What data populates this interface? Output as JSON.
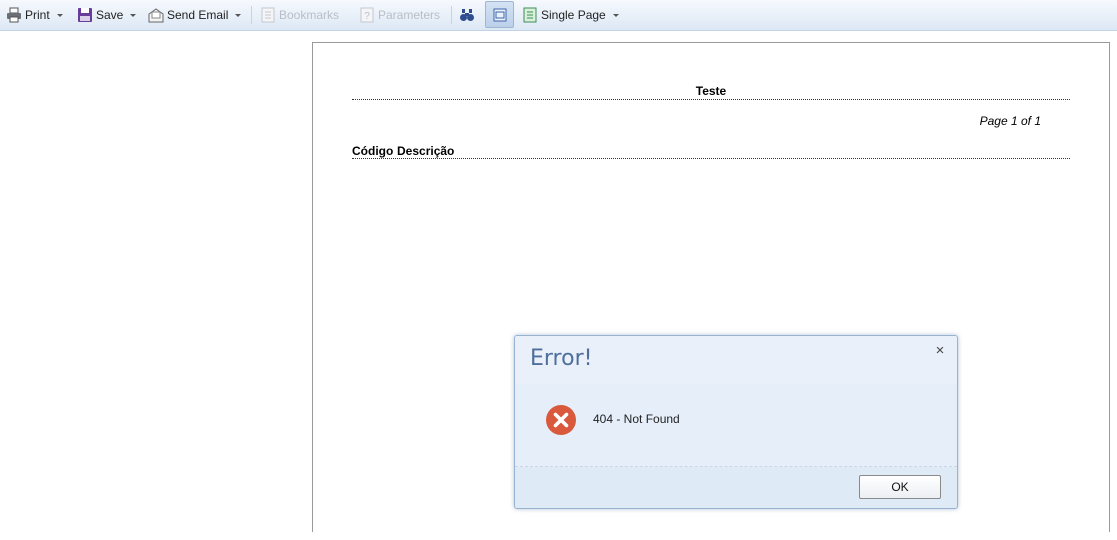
{
  "toolbar": {
    "print_label": "Print",
    "save_label": "Save",
    "send_email_label": "Send Email",
    "bookmarks_label": "Bookmarks",
    "parameters_label": "Parameters",
    "view_mode_label": "Single Page",
    "icons": [
      "printer-icon",
      "save-disk-icon",
      "send-email-icon",
      "bookmarks-icon",
      "parameters-icon",
      "find-binoculars-icon",
      "page-view-icon",
      "single-page-icon"
    ]
  },
  "report": {
    "title": "Teste",
    "page_info": "Page 1 of 1",
    "columns": [
      "Código",
      "Descrição"
    ]
  },
  "dialog": {
    "title": "Error!",
    "close_glyph": "×",
    "message": "404 - Not Found",
    "ok_label": "OK",
    "icon": "error-x-icon",
    "icon_color": "#d9593c"
  },
  "colors": {
    "toolbar_top": "#f6f9fd",
    "toolbar_bottom": "#dde8f5",
    "dialog_title": "#4e6f9c",
    "dialog_bg": "#dfeaf7"
  }
}
